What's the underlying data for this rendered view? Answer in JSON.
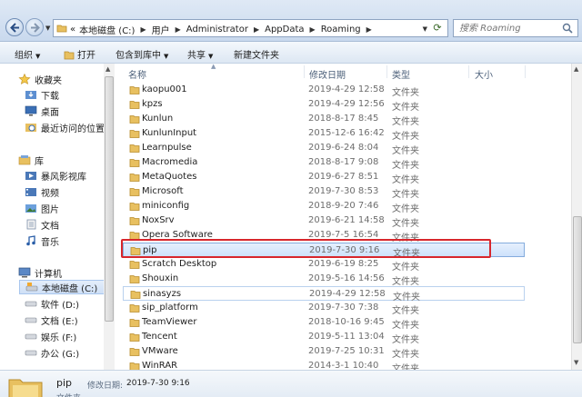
{
  "address_bar": {
    "lead": "«",
    "crumbs": [
      "本地磁盘 (C:)",
      "用户",
      "Administrator",
      "AppData",
      "Roaming"
    ],
    "search_placeholder": "搜索 Roaming"
  },
  "toolbar": {
    "organize": "组织",
    "open": "打开",
    "include_in_library": "包含到库中",
    "share": "共享",
    "new_folder": "新建文件夹"
  },
  "nav": {
    "favorites": "收藏夹",
    "downloads": "下载",
    "desktop": "桌面",
    "recent": "最近访问的位置",
    "libraries": "库",
    "baofeng": "暴风影视库",
    "videos": "视频",
    "pictures": "图片",
    "documents": "文档",
    "music": "音乐",
    "computer": "计算机",
    "drive_c": "本地磁盘 (C:)",
    "drive_d": "软件 (D:)",
    "drive_e": "文档 (E:)",
    "drive_f": "娱乐 (F:)",
    "drive_g": "办公 (G:)"
  },
  "columns": {
    "name": "名称",
    "date": "修改日期",
    "type": "类型",
    "size": "大小"
  },
  "files": [
    {
      "name": "kaopu001",
      "date": "2019-4-29 12:58",
      "type": "文件夹"
    },
    {
      "name": "kpzs",
      "date": "2019-4-29 12:56",
      "type": "文件夹"
    },
    {
      "name": "Kunlun",
      "date": "2018-8-17 8:45",
      "type": "文件夹"
    },
    {
      "name": "KunlunInput",
      "date": "2015-12-6 16:42",
      "type": "文件夹"
    },
    {
      "name": "Learnpulse",
      "date": "2019-6-24 8:04",
      "type": "文件夹"
    },
    {
      "name": "Macromedia",
      "date": "2018-8-17 9:08",
      "type": "文件夹"
    },
    {
      "name": "MetaQuotes",
      "date": "2019-6-27 8:51",
      "type": "文件夹"
    },
    {
      "name": "Microsoft",
      "date": "2019-7-30 8:53",
      "type": "文件夹"
    },
    {
      "name": "miniconfig",
      "date": "2018-9-20 7:46",
      "type": "文件夹"
    },
    {
      "name": "NoxSrv",
      "date": "2019-6-21 14:58",
      "type": "文件夹"
    },
    {
      "name": "Opera Software",
      "date": "2019-7-5 16:54",
      "type": "文件夹"
    },
    {
      "name": "pip",
      "date": "2019-7-30 9:16",
      "type": "文件夹"
    },
    {
      "name": "Scratch Desktop",
      "date": "2019-6-19 8:25",
      "type": "文件夹"
    },
    {
      "name": "Shouxin",
      "date": "2019-5-16 14:56",
      "type": "文件夹"
    },
    {
      "name": "sinasyzs",
      "date": "2019-4-29 12:58",
      "type": "文件夹"
    },
    {
      "name": "sip_platform",
      "date": "2019-7-30 7:38",
      "type": "文件夹"
    },
    {
      "name": "TeamViewer",
      "date": "2018-10-16 9:45",
      "type": "文件夹"
    },
    {
      "name": "Tencent",
      "date": "2019-5-11 13:04",
      "type": "文件夹"
    },
    {
      "name": "VMware",
      "date": "2019-7-25 10:31",
      "type": "文件夹"
    },
    {
      "name": "WinRAR",
      "date": "2014-3-1 10:40",
      "type": "文件夹"
    }
  ],
  "details": {
    "name": "pip",
    "date_label": "修改日期:",
    "date_value": "2019-7-30 9:16",
    "type": "文件夹"
  },
  "colors": {
    "highlight": "#d8262c",
    "selection": "#cde1fb",
    "folder": "#e8c060"
  }
}
